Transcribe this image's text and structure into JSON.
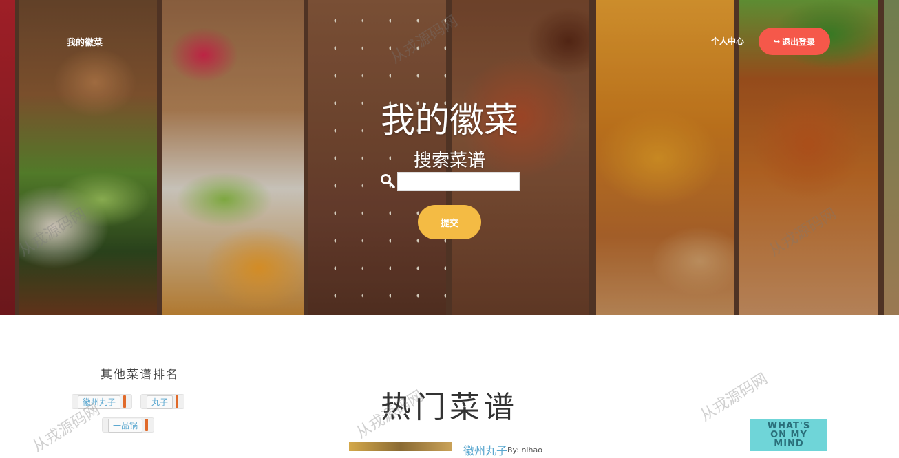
{
  "header": {
    "brand": "我的徽菜",
    "user_center": "个人中心",
    "logout_label": "退出登录"
  },
  "hero": {
    "title": "我的徽菜",
    "search_label": "搜索菜谱",
    "search_value": "",
    "submit_label": "提交"
  },
  "sidebar": {
    "title": "其他菜谱排名",
    "tags": [
      "徽州丸子",
      "丸子",
      "一品锅"
    ]
  },
  "main": {
    "title": "热门菜谱",
    "recipes": [
      {
        "name": "徽州丸子",
        "by": "By: nihao"
      }
    ]
  },
  "ad": {
    "text_lines": [
      "WHAT'S",
      "ON MY",
      "MIND"
    ]
  },
  "watermark": "从戎源码网",
  "colors": {
    "logout_bg": "#f5584a",
    "submit_bg": "#f4bb44",
    "link": "#5aa7cf"
  }
}
